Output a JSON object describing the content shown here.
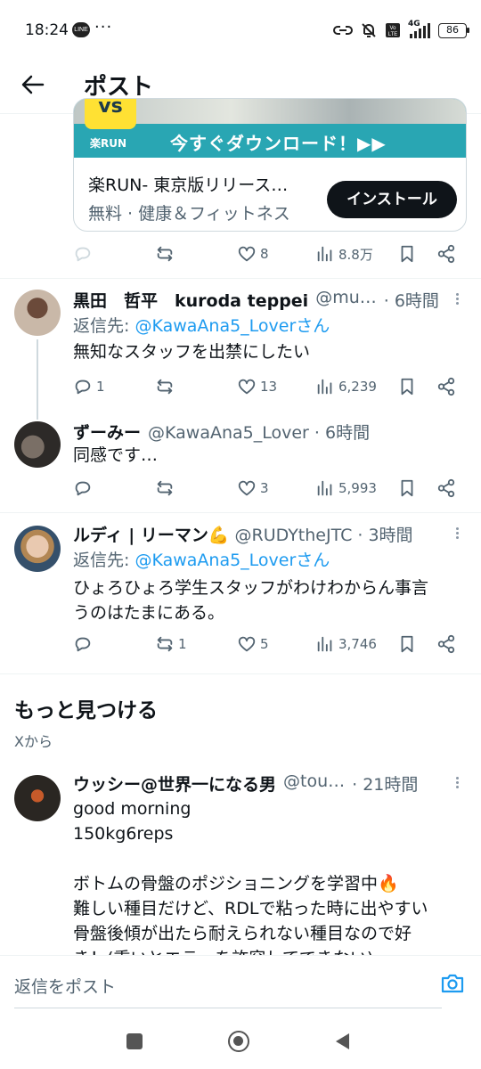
{
  "status_bar": {
    "time": "18:24",
    "line_badge": "LINE",
    "dots": "···",
    "battery": "86",
    "net": "4G"
  },
  "header": {
    "title": "ポスト"
  },
  "ad": {
    "logo": "vs",
    "logo_label": "楽RUN",
    "banner_cta": "今すぐダウンロード！▶▶",
    "title": "楽RUN- 東京版リリース…",
    "subtitle": "無料 · 健康＆フィットネス",
    "install_label": "インストール",
    "actions": {
      "reply": "",
      "repost": "",
      "like": "8",
      "views": "8.8万"
    }
  },
  "posts": [
    {
      "name": "黒田　哲平　kuroda teppei",
      "handle": "@mu…",
      "time": "· 6時間",
      "reply_to_prefix": "返信先: ",
      "reply_to": "@KawaAna5_Loverさん",
      "text": "無知なスタッフを出禁にしたい",
      "actions": {
        "reply": "1",
        "repost": "",
        "like": "13",
        "views": "6,239"
      }
    },
    {
      "name": "ずーみー",
      "handle": "@KawaAna5_Lover · 6時間",
      "text": "同感です…",
      "actions": {
        "reply": "",
        "repost": "",
        "like": "3",
        "views": "5,993"
      }
    },
    {
      "name": "ルディ | リーマン💪",
      "handle": "@RUDYtheJTC · 3時間",
      "reply_to_prefix": "返信先: ",
      "reply_to": "@KawaAna5_Loverさん",
      "text_line1": "ひょろひょろ学生スタッフがわけわからん事言",
      "text_line2": "うのはたまにある。",
      "actions": {
        "reply": "",
        "repost": "1",
        "like": "5",
        "views": "3,746"
      }
    }
  ],
  "discover": {
    "title": "もっと見つける",
    "subtitle": "Xから",
    "post": {
      "name": "ウッシー@世界一になる男",
      "handle": "@tou…",
      "time": "· 21時間",
      "lines": [
        "good morning",
        "150kg6reps",
        "ボトムの骨盤のポジショニングを学習中🔥",
        "難しい種目だけど、RDLで粘った時に出やすい",
        "骨盤後傾が出たら耐えられない種目なので好",
        "き！(重いとエラーを許容してできない)"
      ]
    }
  },
  "reply_bar": {
    "placeholder": "返信をポスト"
  },
  "colors": {
    "accent": "#1d9bf0",
    "text": "#0f1419",
    "muted": "#536471",
    "ad_banner": "#29a6b3"
  }
}
